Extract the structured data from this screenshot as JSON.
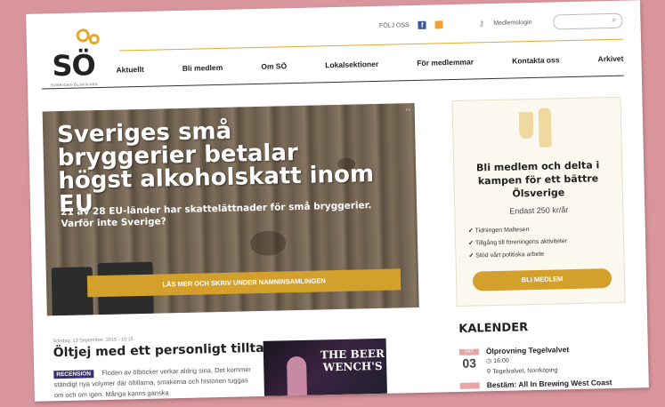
{
  "brand": {
    "logo_text": "SÖ",
    "tagline": "SVERIGES ÖLSKIKARA",
    "gold": "#d3a12b",
    "purple": "#3b2f72"
  },
  "topbar": {
    "follow_label": "FÖLJ OSS",
    "facebook_icon": "facebook-icon",
    "rss_icon": "rss-icon",
    "login_label": "Medlemslogin",
    "search_placeholder": ""
  },
  "nav": {
    "items": [
      "Aktuellt",
      "Bli medlem",
      "Om SÖ",
      "Lokalsektioner",
      "För medlemmar",
      "Kontakta oss",
      "Arkivet"
    ]
  },
  "hero": {
    "headline": "Sveriges små bryggerier betalar högst alkoholskatt inom EU",
    "subtext": "21 av 28 EU-länder har skattelättnader för små bryggerier. Varför inte Sverige?",
    "cta": "LÄS MER OCH SKRIV UNDER NAMNINSAMLINGEN"
  },
  "membership": {
    "title": "Bli medlem och delta i kampen för ett bättre Ölsverige",
    "price": "Endast 250 kr/år",
    "benefits": [
      "Tidningen Maltesen",
      "Tillgång till föreningens aktiviteter",
      "Stöd vårt politiska arbete"
    ],
    "button": "BLI MEDLEM"
  },
  "article": {
    "date": "Söndag, 13 September, 2015 - 10:15",
    "title": "Öltjej med ett personligt tilltal",
    "tag": "RECENSION",
    "excerpt": "Floden av ölböcker verkar aldrig sina. Det kommer ständigt nya volymer där öltillarna, smakerna och historien tuggas om och om igen. Många kanns ganska",
    "image_title": "THE BEER WENCH'S"
  },
  "calendar": {
    "heading": "KALENDER",
    "events": [
      {
        "month": "OKT",
        "day": "03",
        "title": "Ölprovning Tegelvalvet",
        "time": "16:00",
        "place": "Tegelvalvet, Norrköping"
      },
      {
        "month": "",
        "day": "",
        "title": "Bestäm: All In Brewing West Coast",
        "time": "",
        "place": ""
      }
    ]
  }
}
